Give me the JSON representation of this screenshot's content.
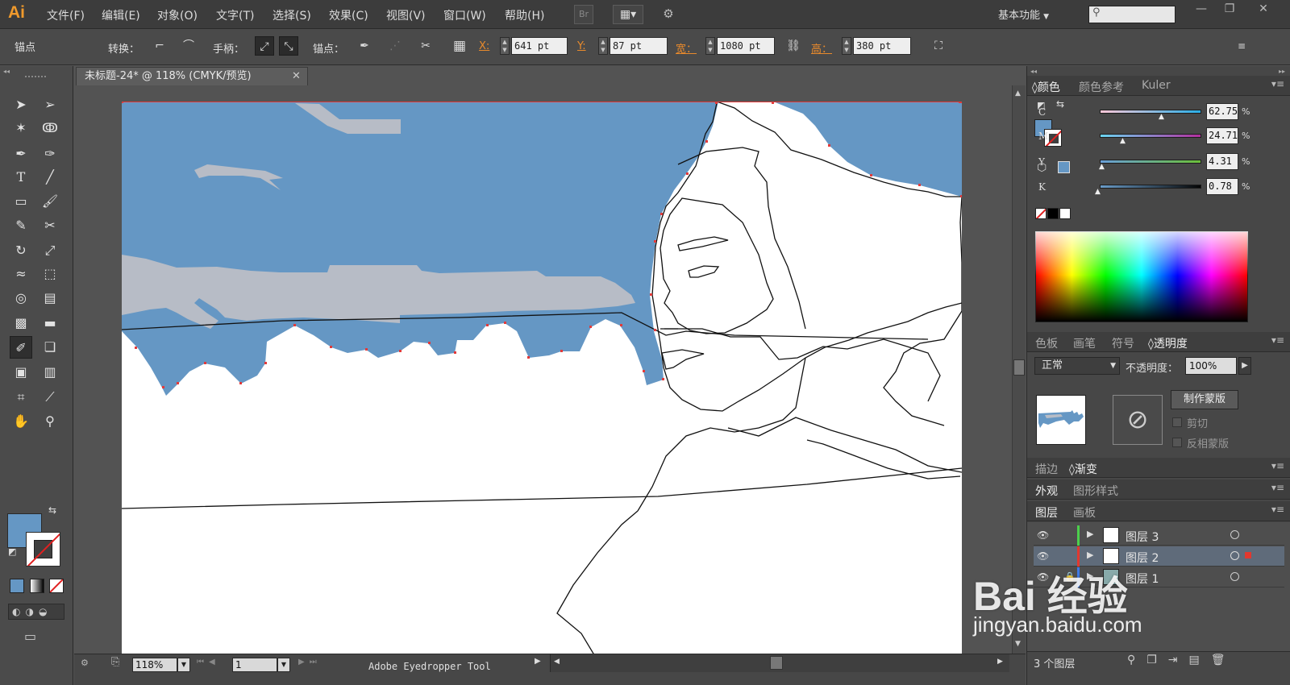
{
  "app": {
    "logo": "Ai"
  },
  "menus": [
    "文件(F)",
    "编辑(E)",
    "对象(O)",
    "文字(T)",
    "选择(S)",
    "效果(C)",
    "视图(V)",
    "窗口(W)",
    "帮助(H)"
  ],
  "menubar": {
    "bridge_label": "Br",
    "workspace": "基本功能"
  },
  "control": {
    "selection_type": "锚点",
    "convert_label": "转换：",
    "handles_label": "手柄：",
    "anchors_label": "锚点：",
    "x_label": "X:",
    "x_value": "641 pt",
    "y_label": "Y:",
    "y_value": "87 pt",
    "w_label": "宽：",
    "w_value": "1080 pt",
    "h_label": "高：",
    "h_value": "380 pt"
  },
  "document": {
    "tab_title": "未标题-24* @ 118% (CMYK/预览)"
  },
  "status": {
    "zoom": "118%",
    "artboard": "1",
    "tool_text": "Adobe Eyedropper Tool"
  },
  "colors": {
    "fill": "#6597c4",
    "sky": "#6597c4",
    "cloud": "#b7bcc6",
    "anchor_red": "#e23a3a"
  },
  "color_panel": {
    "tabs": [
      "颜色",
      "颜色参考",
      "Kuler"
    ],
    "channels": [
      {
        "label": "C",
        "value": "62.75"
      },
      {
        "label": "M",
        "value": "24.71"
      },
      {
        "label": "Y",
        "value": "4.31"
      },
      {
        "label": "K",
        "value": "0.78"
      }
    ],
    "percent": "%"
  },
  "transparency_panel": {
    "tabs": [
      "色板",
      "画笔",
      "符号",
      "透明度"
    ],
    "blend_mode": "正常",
    "opacity_label": "不透明度：",
    "opacity_value": "100%",
    "make_mask": "制作蒙版",
    "clip": "剪切",
    "invert": "反相蒙版"
  },
  "stroke_gradient": {
    "tabs": [
      "描边",
      "渐变"
    ]
  },
  "appearance": {
    "tabs": [
      "外观",
      "图形样式"
    ]
  },
  "layers_panel": {
    "tabs": [
      "图层",
      "画板"
    ],
    "layers": [
      {
        "name": "图层 3",
        "color": "#4ccf4c"
      },
      {
        "name": "图层 2",
        "color": "#e2382f"
      },
      {
        "name": "图层 1",
        "color": "#3f7ae6"
      }
    ],
    "count": "3 个图层"
  },
  "watermark": {
    "brand": "Bai 经验",
    "url": "jingyan.baidu.com"
  }
}
